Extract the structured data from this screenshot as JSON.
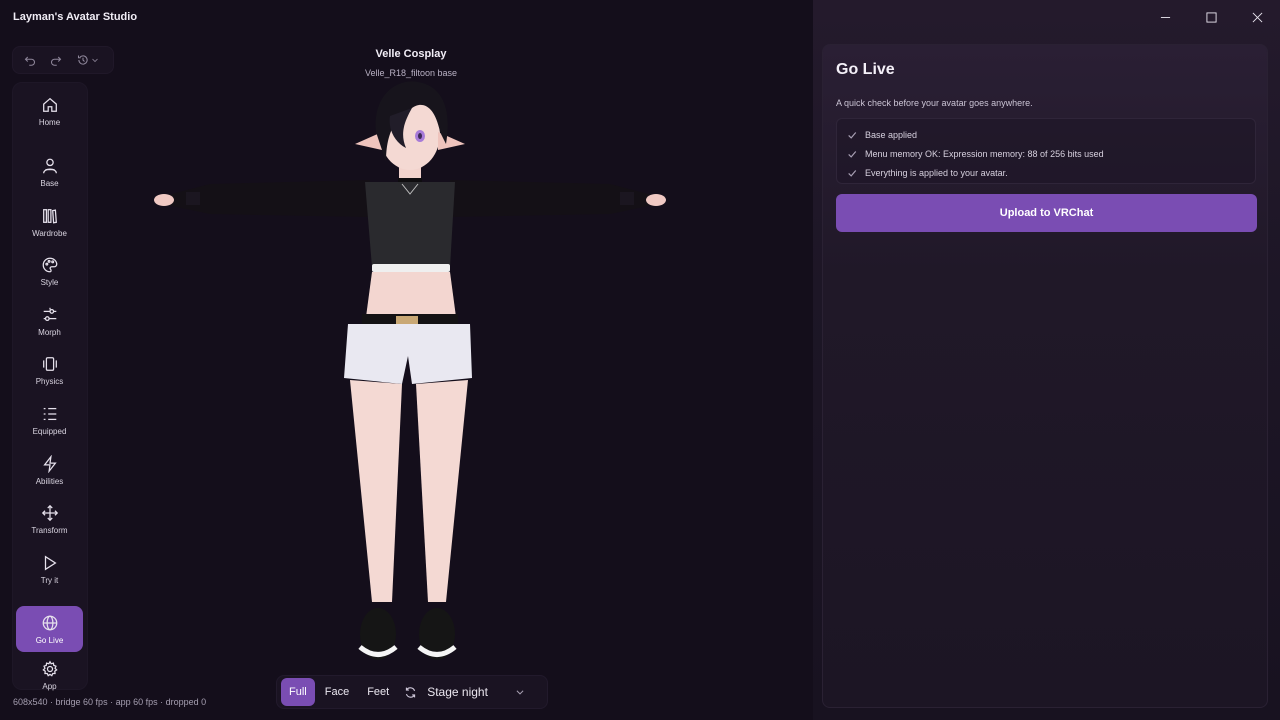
{
  "app": {
    "title": "Layman's Avatar Studio"
  },
  "nav": [
    {
      "label": "Home",
      "icon": "home-icon"
    },
    {
      "label": "Base",
      "icon": "person-icon"
    },
    {
      "label": "Wardrobe",
      "icon": "wardrobe-icon"
    },
    {
      "label": "Style",
      "icon": "palette-icon"
    },
    {
      "label": "Morph",
      "icon": "sliders-icon"
    },
    {
      "label": "Physics",
      "icon": "vibrate-icon"
    },
    {
      "label": "Equipped",
      "icon": "list-icon"
    },
    {
      "label": "Abilities",
      "icon": "lightning-icon"
    },
    {
      "label": "Transform",
      "icon": "move-icon"
    },
    {
      "label": "Try it",
      "icon": "play-icon"
    },
    {
      "label": "Go Live",
      "icon": "globe-icon",
      "active": true
    },
    {
      "label": "App",
      "icon": "gear-icon"
    }
  ],
  "viewport": {
    "avatar_name": "Velle Cosplay",
    "avatar_base": "Velle_R18_filtoon base",
    "status": "608x540 · bridge 60 fps · app 60 fps · dropped 0",
    "view_modes": [
      "Full",
      "Face",
      "Feet"
    ],
    "active_view": "Full",
    "stage": "Stage night"
  },
  "go_live": {
    "title": "Go Live",
    "description": "A quick check before your avatar goes anywhere.",
    "checks": [
      "Base applied",
      "Menu memory OK: Expression memory: 88 of 256 bits used",
      "Everything is applied to your avatar."
    ],
    "upload_label": "Upload to VRChat"
  },
  "colors": {
    "accent": "#7a4db3",
    "background": "#150f1c",
    "panel": "#201828"
  }
}
